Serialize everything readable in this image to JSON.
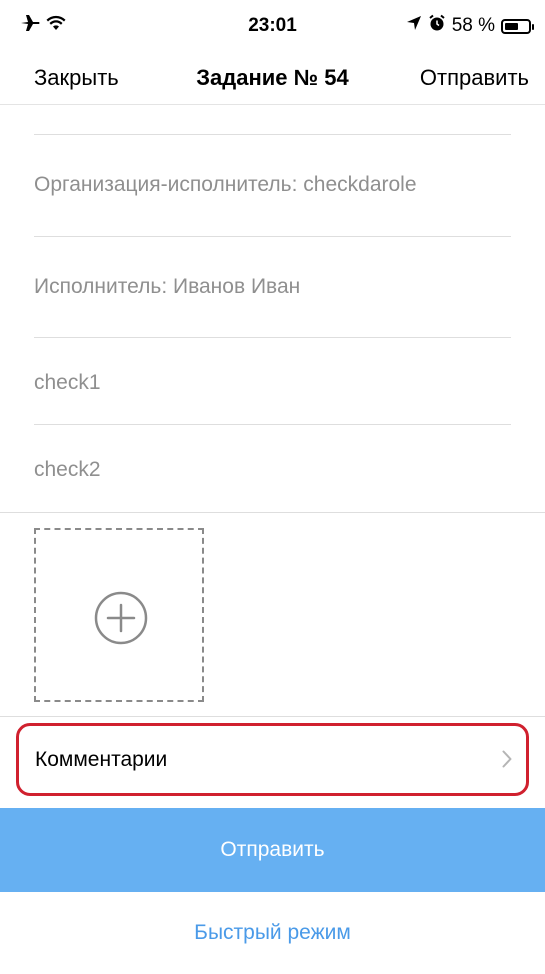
{
  "status_bar": {
    "time": "23:01",
    "battery_text": "58 %",
    "battery_level": 0.58,
    "icons": [
      "airplane-icon",
      "wifi-icon",
      "location-icon",
      "alarm-icon",
      "battery-icon"
    ]
  },
  "nav": {
    "close_label": "Закрыть",
    "title": "Задание № 54",
    "send_label": "Отправить"
  },
  "fields": [
    {
      "text": "Организация-исполнитель: checkdarole"
    },
    {
      "text": "Исполнитель: Иванов Иван"
    },
    {
      "text": "check1"
    },
    {
      "text": "check2"
    }
  ],
  "photo": {
    "icon": "plus-circle-icon"
  },
  "comments": {
    "label": "Комментарии",
    "icon": "chevron-right-icon"
  },
  "buttons": {
    "send_label": "Отправить",
    "fast_mode_label": "Быстрый режим"
  },
  "colors": {
    "primary": "#66b0f2",
    "link": "#4a9ae8",
    "highlight": "#d0202e",
    "secondary_text": "#8f8f8f"
  }
}
